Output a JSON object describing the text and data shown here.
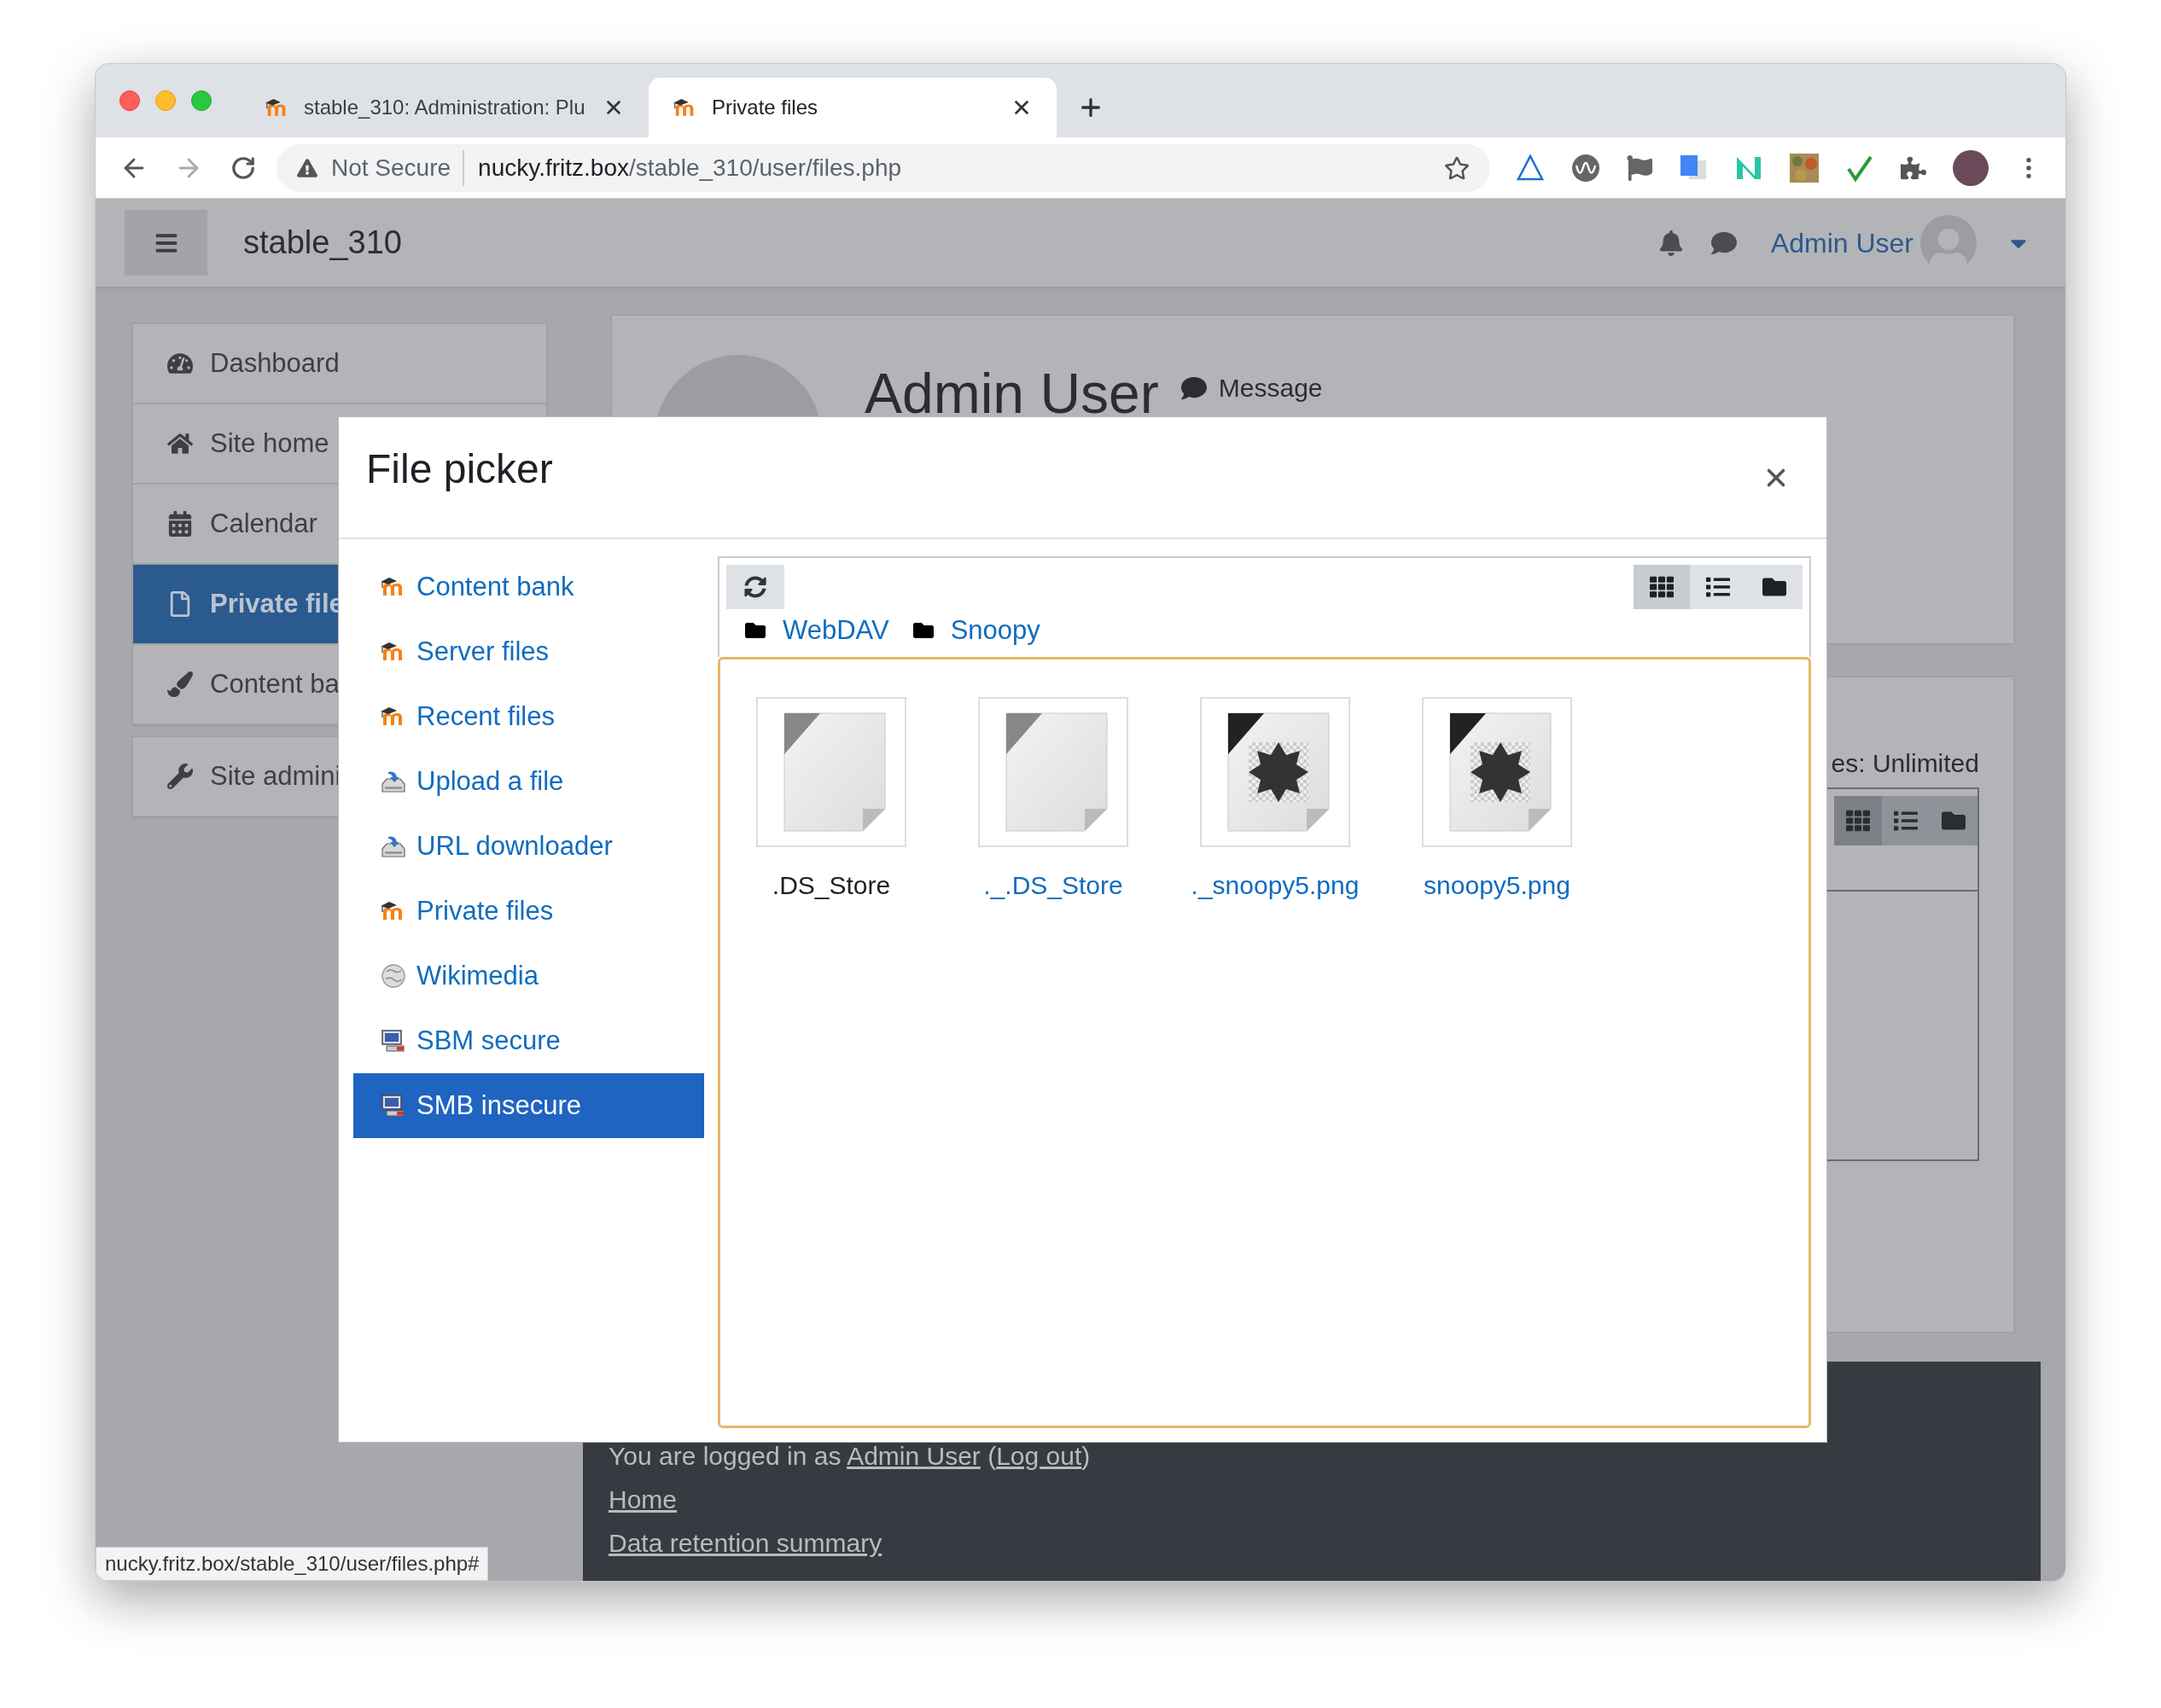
{
  "browser": {
    "tabs": [
      {
        "title": "stable_310: Administration: Plu",
        "selected": false
      },
      {
        "title": "Private files",
        "selected": true
      }
    ],
    "address": {
      "security": "Not Secure",
      "host": "nucky.fritz.box",
      "path": "/stable_310/user/files.php"
    }
  },
  "navbar": {
    "site_name": "stable_310",
    "user_name": "Admin User"
  },
  "sidebar": {
    "groups": [
      [
        {
          "label": "Dashboard",
          "selected": false
        },
        {
          "label": "Site home",
          "selected": false
        },
        {
          "label": "Calendar",
          "selected": false
        },
        {
          "label": "Private file",
          "selected": true
        },
        {
          "label": "Content ba",
          "selected": false
        }
      ],
      [
        {
          "label": "Site admini",
          "selected": false
        }
      ]
    ]
  },
  "profile": {
    "name": "Admin User",
    "message_button": "Message"
  },
  "files_card": {
    "quota_text": "es: Unlimited",
    "view_modes": [
      {
        "selected": true
      },
      {
        "selected": false
      },
      {
        "selected": false
      }
    ]
  },
  "file_picker": {
    "title": "File picker",
    "repositories": [
      {
        "label": "Content bank",
        "kind": "moodle",
        "selected": false
      },
      {
        "label": "Server files",
        "kind": "moodle",
        "selected": false
      },
      {
        "label": "Recent files",
        "kind": "moodle",
        "selected": false
      },
      {
        "label": "Upload a file",
        "kind": "upload",
        "selected": false
      },
      {
        "label": "URL downloader",
        "kind": "upload",
        "selected": false
      },
      {
        "label": "Private files",
        "kind": "moodle",
        "selected": false
      },
      {
        "label": "Wikimedia",
        "kind": "wiki",
        "selected": false
      },
      {
        "label": "SBM secure",
        "kind": "smb",
        "selected": false
      },
      {
        "label": "SMB insecure",
        "kind": "smb",
        "selected": true
      }
    ],
    "view_modes": [
      {
        "selected": true
      },
      {
        "selected": false
      },
      {
        "selected": false
      }
    ],
    "path": [
      "WebDAV",
      "Snoopy"
    ],
    "files": [
      {
        "name": ".DS_Store",
        "kind": "document",
        "highlighted": true
      },
      {
        "name": "._.DS_Store",
        "kind": "document",
        "highlighted": false
      },
      {
        "name": "._snoopy5.png",
        "kind": "image",
        "highlighted": false
      },
      {
        "name": "snoopy5.png",
        "kind": "image",
        "highlighted": false
      }
    ]
  },
  "footer": {
    "text": "You are logged in as ",
    "user_link": "Admin User",
    "between": " (",
    "logout_link": "Log out",
    "after": ")",
    "links": [
      "Home",
      "Data retention summary"
    ]
  },
  "status_url": "nucky.fritz.box/stable_310/user/files.php#"
}
